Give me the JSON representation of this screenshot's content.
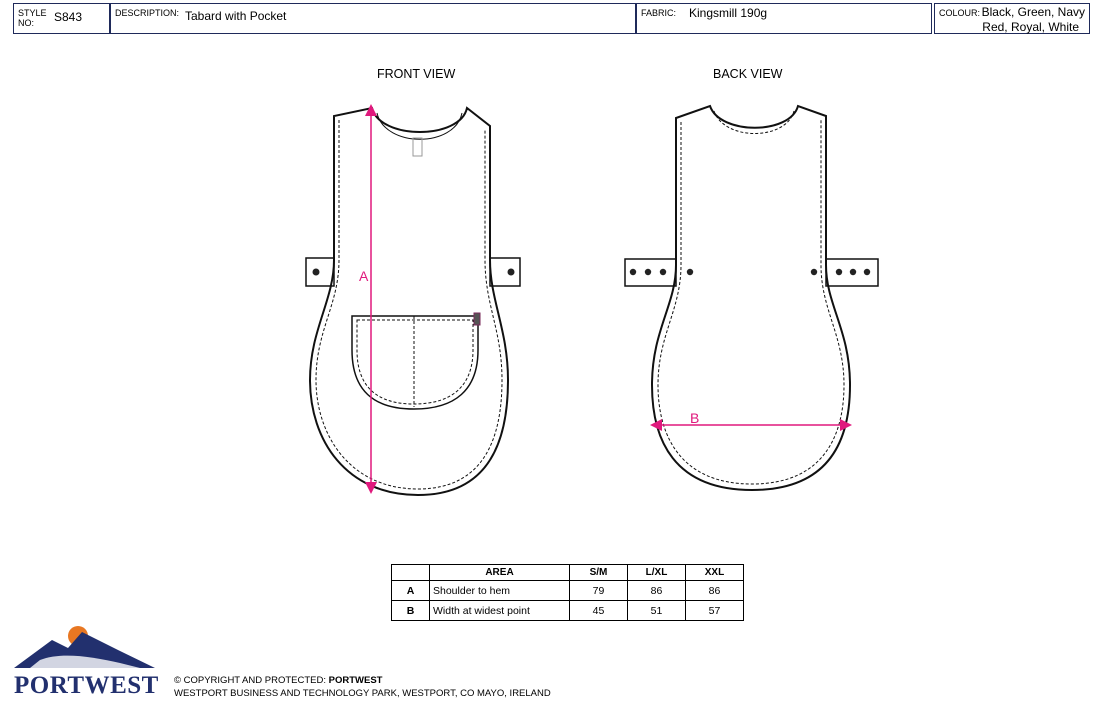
{
  "header": {
    "style_label": "STYLE NO:",
    "style_value": "S843",
    "description_label": "DESCRIPTION:",
    "description_value": "Tabard with Pocket",
    "fabric_label": "FABRIC:",
    "fabric_value": "Kingsmill 190g",
    "colour_label": "COLOUR:",
    "colour_line1": "Black, Green, Navy",
    "colour_line2": "Red, Royal, White"
  },
  "views": {
    "front_title": "FRONT VIEW",
    "back_title": "BACK VIEW",
    "marker_a": "A",
    "marker_b": "B",
    "measure_color": "#e0197d"
  },
  "table": {
    "headers": [
      "",
      "AREA",
      "S/M",
      "L/XL",
      "XXL"
    ],
    "rows": [
      {
        "code": "A",
        "area": "Shoulder to hem",
        "sm": "79",
        "lxl": "86",
        "xxl": "86"
      },
      {
        "code": "B",
        "area": "Width at widest point",
        "sm": "45",
        "lxl": "51",
        "xxl": "57"
      }
    ]
  },
  "footer": {
    "copyright_prefix": "© COPYRIGHT AND PROTECTED: ",
    "copyright_brand": "PORTWEST",
    "address": "WESTPORT BUSINESS AND TECHNOLOGY PARK, WESTPORT, CO MAYO, IRELAND",
    "brand_name": "PORTWEST",
    "brand_color": "#22306e",
    "sun_color": "#e87722"
  }
}
